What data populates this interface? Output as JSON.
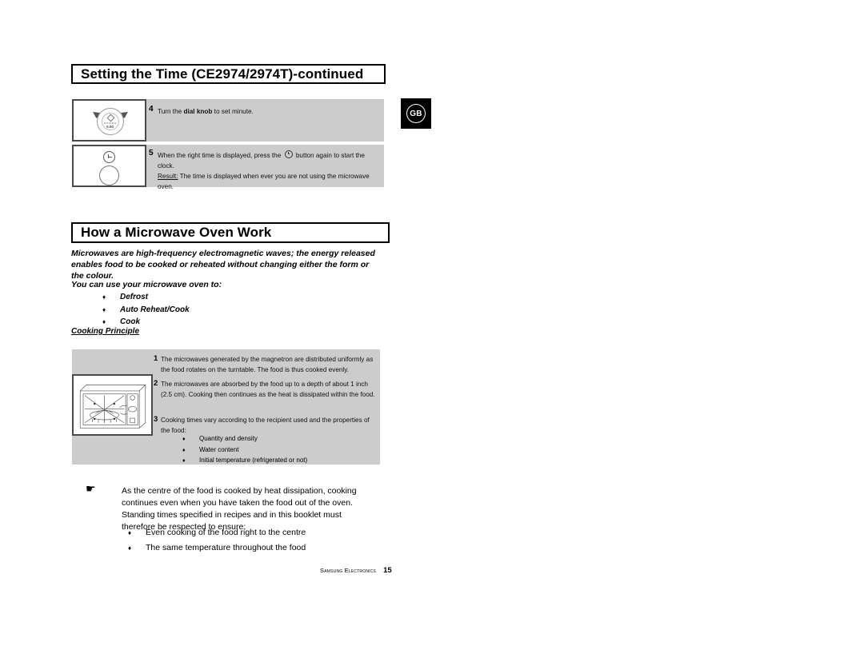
{
  "document": {
    "language_badge": "GB",
    "footer": {
      "brand": "Samsung Electronics",
      "page_number": "15"
    }
  },
  "section_setting_time": {
    "heading": "Setting the Time (CE2974/2974T)-continued",
    "steps": [
      {
        "number": "4",
        "illustration": "dial-knob-rotation",
        "text_before_bold": "Turn the ",
        "bold": "dial knob",
        "text_after_bold": " to set minute.",
        "dial_label": "0.00"
      },
      {
        "number": "5",
        "illustration": "clock-button",
        "line1_part1": "When the right time is displayed, press the",
        "line1_part2": "button again to start the clock.",
        "result_label": "Result:",
        "result_text": "The time is displayed when ever you are not using the microwave oven."
      }
    ]
  },
  "section_how_it_works": {
    "heading": "How a Microwave Oven Work",
    "intro_paragraph": "Microwaves are high-frequency electromagnetic waves; the energy released enables food to be cooked or reheated without changing either the form or the colour.",
    "use_intro": "You can use your microwave oven to:",
    "use_items": [
      "Defrost",
      "Auto Reheat/Cook",
      "Cook"
    ],
    "bullet_glyph": "♦",
    "cooking_principle_heading": "Cooking Principle",
    "principle_items": [
      {
        "number": "1",
        "text": "The microwaves generated by the magnetron are distributed uniformly as the food rotates on the turntable. The food is thus cooked evenly."
      },
      {
        "number": "2",
        "text": "The microwaves are absorbed by the food up to a depth of about 1 inch (2.5 cm). Cooking then continues as the heat is dissipated within the food."
      },
      {
        "number": "3",
        "text": "Cooking times vary according to the recipient used and the properties of the food:"
      }
    ],
    "principle_sub_items": [
      "Quantity and density",
      "Water content",
      "Initial temperature (refrigerated or not)"
    ],
    "illustration": "microwave-oven-cutaway"
  },
  "note": {
    "hand_icon": "☛",
    "text": "As the centre of the food is cooked by heat dissipation, cooking continues even when you have taken the food out of the oven. Standing times specified in recipes and in this booklet must therefore be respected to ensure:",
    "items": [
      "Even cooking of the food right to the centre",
      "The same temperature throughout the food"
    ],
    "bullet_glyph": "♦"
  },
  "colors": {
    "panel_gray": "#cccccc",
    "text_black": "#000000",
    "badge_black": "#000000"
  }
}
